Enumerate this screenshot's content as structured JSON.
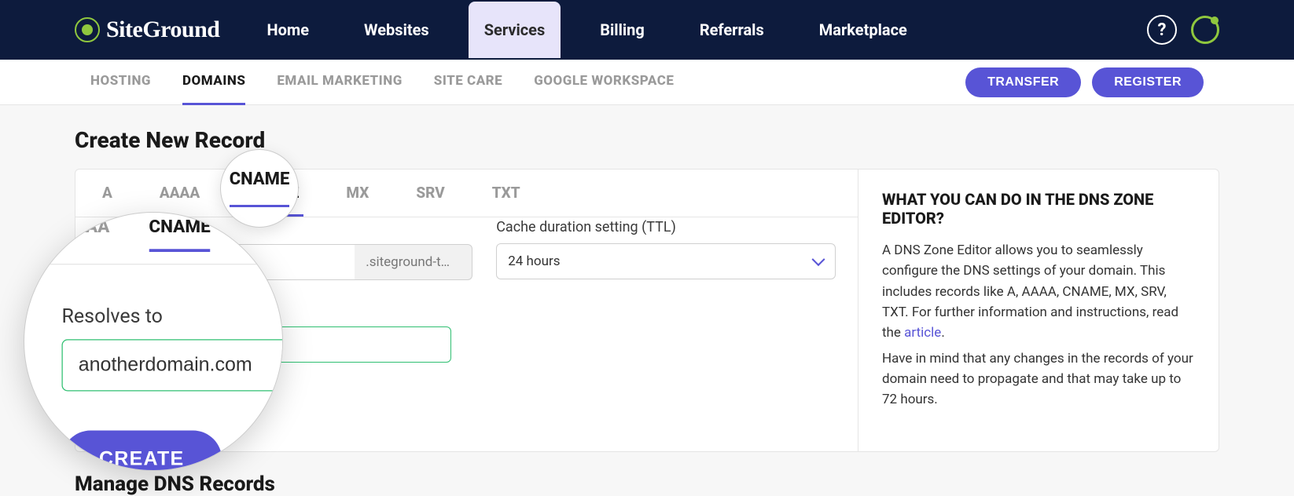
{
  "brand": "SiteGround",
  "nav": [
    "Home",
    "Websites",
    "Services",
    "Billing",
    "Referrals",
    "Marketplace"
  ],
  "nav_active": 2,
  "subnav": [
    "HOSTING",
    "DOMAINS",
    "EMAIL MARKETING",
    "SITE CARE",
    "GOOGLE WORKSPACE"
  ],
  "subnav_active": 1,
  "actions": {
    "transfer": "TRANSFER",
    "register": "REGISTER"
  },
  "page_title": "Create New Record",
  "record_tabs": [
    "A",
    "AAAA",
    "CNAME",
    "MX",
    "SRV",
    "TXT"
  ],
  "record_tab_active": 2,
  "form": {
    "name_suffix": ".siteground-t…",
    "ttl_label": "Cache duration setting (TTL)",
    "ttl_value": "24 hours",
    "resolves_label": "Resolves to",
    "resolves_value": "anotherdomain.com",
    "create": "CREATE"
  },
  "help": {
    "title": "WHAT YOU CAN DO IN THE DNS ZONE EDITOR?",
    "p1a": "A DNS Zone Editor allows you to seamlessly configure the DNS settings of your domain. This includes records like A, AAAA, CNAME, MX, SRV, TXT. For further information and instructions, read the ",
    "link": "article",
    "p1b": ".",
    "p2": "Have in mind that any changes in the records of your domain need to propagate and that may take up to 72 hours."
  },
  "manage_title": "Manage DNS Records"
}
